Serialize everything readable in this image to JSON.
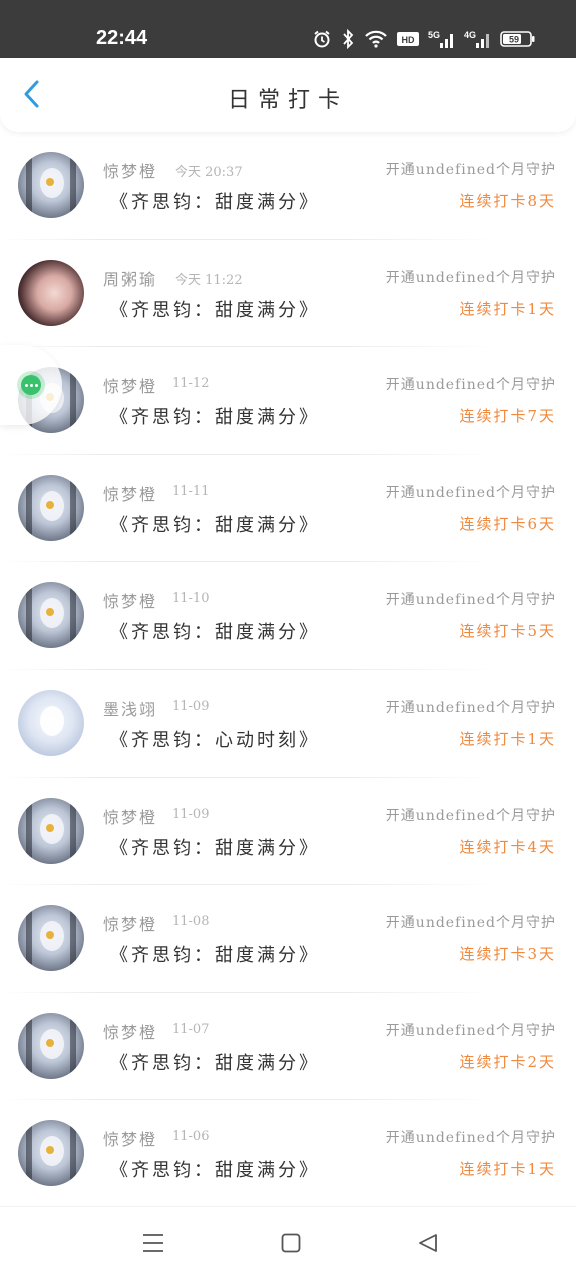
{
  "status_bar": {
    "time": "22:44",
    "icons": [
      "alarm-icon",
      "bluetooth-icon",
      "wifi-icon",
      "hd-icon",
      "5g-signal-icon",
      "4g-signal-icon",
      "battery-icon"
    ],
    "hd_label": "HD",
    "net1_label": "5G",
    "net2_label": "4G",
    "battery_level": "59"
  },
  "header": {
    "title": "日常打卡",
    "back_icon": "chevron-left-icon"
  },
  "rows": [
    {
      "name": "惊梦橙",
      "date": "今天 20:37",
      "book": "《齐思钧：甜度满分》",
      "guard": "开通undefined个月守护",
      "streak": "连续打卡8天"
    },
    {
      "name": "周粥瑜",
      "date": "今天 11:22",
      "book": "《齐思钧：甜度满分》",
      "guard": "开通undefined个月守护",
      "streak": "连续打卡1天"
    },
    {
      "name": "惊梦橙",
      "date": "11-12",
      "book": "《齐思钧：甜度满分》",
      "guard": "开通undefined个月守护",
      "streak": "连续打卡7天"
    },
    {
      "name": "惊梦橙",
      "date": "11-11",
      "book": "《齐思钧：甜度满分》",
      "guard": "开通undefined个月守护",
      "streak": "连续打卡6天"
    },
    {
      "name": "惊梦橙",
      "date": "11-10",
      "book": "《齐思钧：甜度满分》",
      "guard": "开通undefined个月守护",
      "streak": "连续打卡5天"
    },
    {
      "name": "墨浅翊",
      "date": "11-09",
      "book": "《齐思钧：心动时刻》",
      "guard": "开通undefined个月守护",
      "streak": "连续打卡1天"
    },
    {
      "name": "惊梦橙",
      "date": "11-09",
      "book": "《齐思钧：甜度满分》",
      "guard": "开通undefined个月守护",
      "streak": "连续打卡4天"
    },
    {
      "name": "惊梦橙",
      "date": "11-08",
      "book": "《齐思钧：甜度满分》",
      "guard": "开通undefined个月守护",
      "streak": "连续打卡3天"
    },
    {
      "name": "惊梦橙",
      "date": "11-07",
      "book": "《齐思钧：甜度满分》",
      "guard": "开通undefined个月守护",
      "streak": "连续打卡2天"
    },
    {
      "name": "惊梦橙",
      "date": "11-06",
      "book": "《齐思钧：甜度满分》",
      "guard": "开通undefined个月守护",
      "streak": "连续打卡1天"
    }
  ],
  "floating_button": {
    "icon": "chat-bubble-icon"
  },
  "nav_bar": {
    "icons": [
      "menu-icon",
      "home-square-icon",
      "back-triangle-icon"
    ]
  },
  "colors": {
    "status_bar_bg": "#3c3c3c",
    "accent_blue": "#2f9be0",
    "streak_orange": "#f0893d",
    "muted_text": "#9a9a9a",
    "primary_text": "#333333"
  }
}
